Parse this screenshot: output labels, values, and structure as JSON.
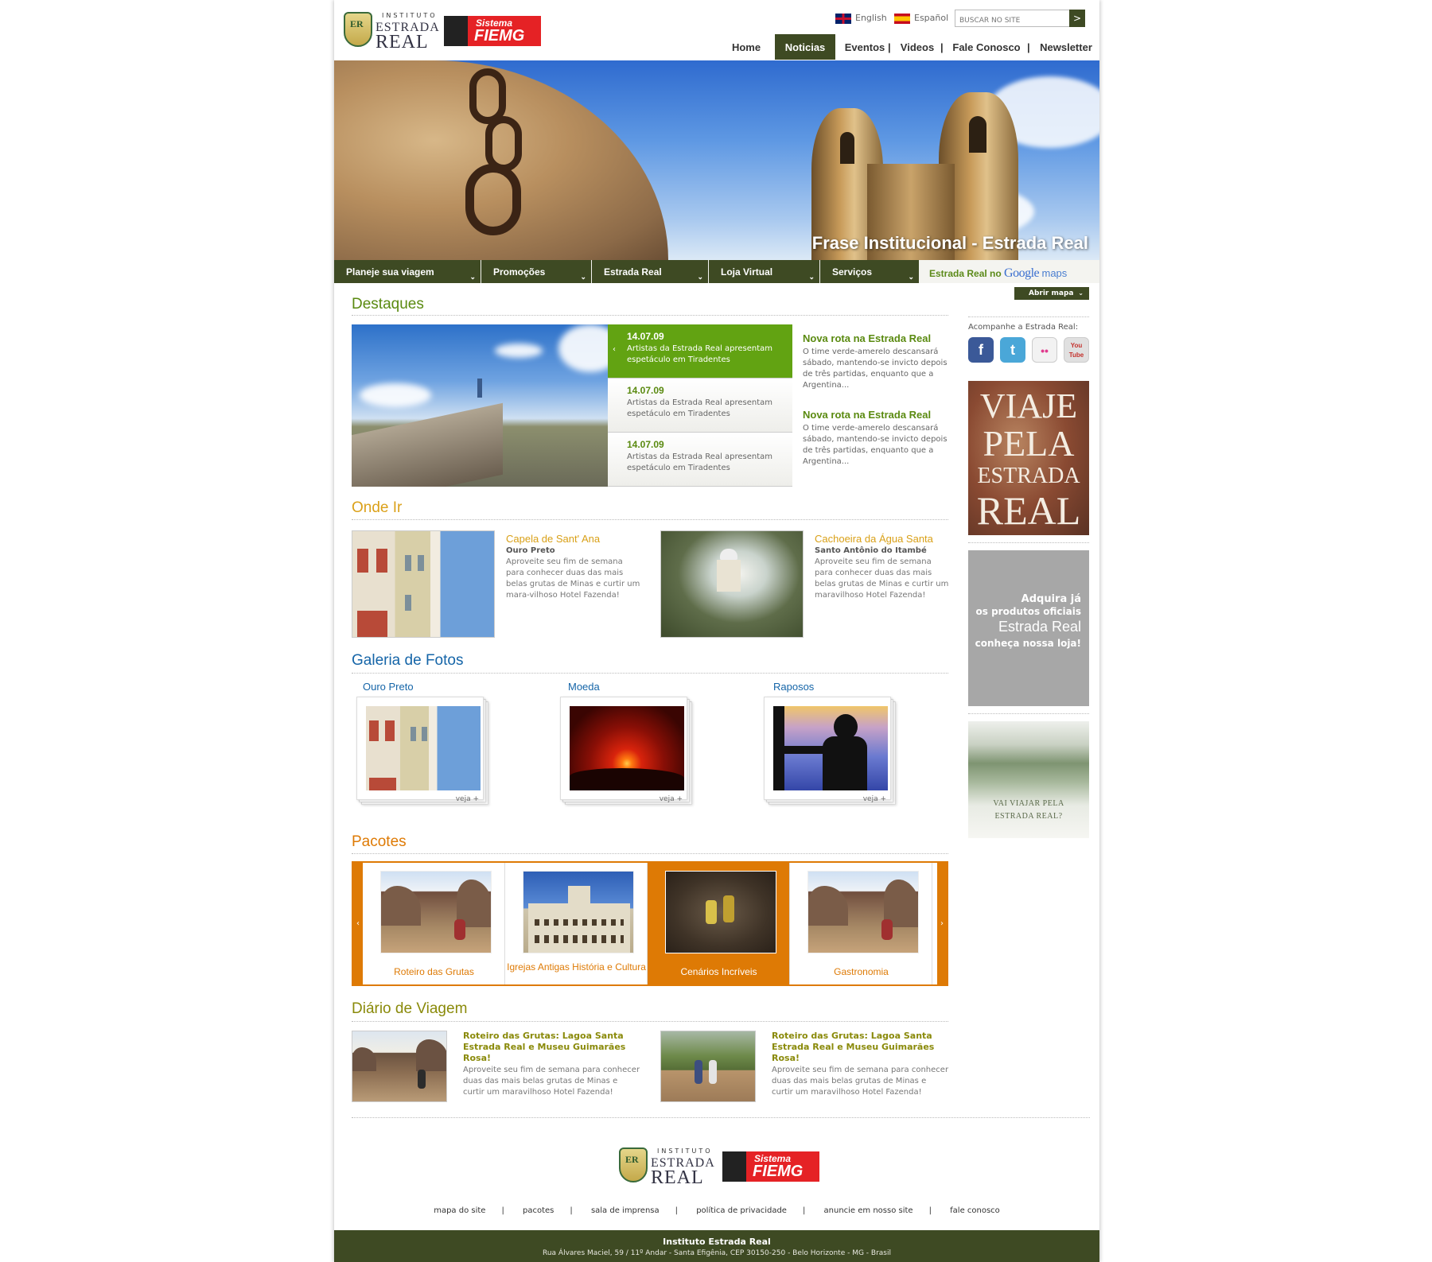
{
  "header": {
    "logo_instituto": {
      "small": "INSTITUTO",
      "line1": "ESTRADA",
      "line2": "REAL",
      "mark": "ER"
    },
    "logo_fiemg": {
      "line1": "Sistema",
      "line2": "FIEMG"
    },
    "languages": [
      {
        "label": "English",
        "flag": "uk-flag-icon"
      },
      {
        "label": "Español",
        "flag": "spain-flag-icon"
      }
    ],
    "search": {
      "placeholder": "BUSCAR NO SITE",
      "button": ">"
    },
    "nav": [
      "Home",
      "Noticias",
      "Eventos",
      "Videos",
      "Fale Conosco",
      "Newsletter"
    ],
    "nav_active": "Noticias",
    "nav_separator": "|"
  },
  "hero": {
    "caption": "Frase Institucional - Estrada Real"
  },
  "menu": {
    "items": [
      "Planeje sua viagem",
      "Promoções",
      "Estrada Real",
      "Loja Virtual",
      "Serviços"
    ],
    "dropdown_glyph": "⌄",
    "maps_prefix": "Estrada Real no",
    "maps_brand": "Google",
    "maps_suffix": "maps",
    "open_map": "Abrir mapa"
  },
  "destaques": {
    "title": "Destaques",
    "items": [
      {
        "date": "14.07.09",
        "text": "Artistas da Estrada Real apresentam espetáculo em Tiradentes"
      },
      {
        "date": "14.07.09",
        "text": "Artistas da Estrada Real apresentam espetáculo em Tiradentes"
      },
      {
        "date": "14.07.09",
        "text": "Artistas da Estrada Real apresentam espetáculo em Tiradentes"
      }
    ],
    "news": [
      {
        "title": "Nova rota na Estrada Real",
        "text": "O time verde-amerelo descansará sábado, mantendo-se invicto depois de três partidas, enquanto que a Argentina..."
      },
      {
        "title": "Nova rota na Estrada Real",
        "text": "O time verde-amerelo descansará sábado, mantendo-se invicto depois de três partidas, enquanto que a Argentina..."
      }
    ]
  },
  "onde_ir": {
    "title": "Onde Ir",
    "items": [
      {
        "title": "Capela de Sant' Ana",
        "place": "Ouro Preto",
        "text": "Aproveite seu fim de semana para conhecer duas das mais belas grutas de Minas e curtir um mara-vilhoso Hotel Fazenda!"
      },
      {
        "title": "Cachoeira da Água Santa",
        "place": "Santo Antônio do Itambé",
        "text": "Aproveite seu fim de semana para conhecer duas das mais belas grutas de Minas e curtir um maravilhoso Hotel Fazenda!"
      }
    ]
  },
  "galeria": {
    "title": "Galeria de Fotos",
    "items": [
      {
        "label": "Ouro Preto",
        "more": "veja +"
      },
      {
        "label": "Moeda",
        "more": "veja +"
      },
      {
        "label": "Raposos",
        "more": "veja +"
      }
    ]
  },
  "pacotes": {
    "title": "Pacotes",
    "prev": "‹",
    "next": "›",
    "items": [
      {
        "label": "Roteiro das Grutas"
      },
      {
        "label": "Igrejas Antigas História e Cultura"
      },
      {
        "label": "Cenários Incríveis"
      },
      {
        "label": "Gastronomia"
      }
    ],
    "active_index": 2
  },
  "diario": {
    "title": "Diário de Viagem",
    "items": [
      {
        "title": "Roteiro das Grutas: Lagoa Santa Estrada Real e Museu Guimarães Rosa!",
        "text": "Aproveite seu fim de semana para conhecer duas das mais belas grutas de Minas e curtir um maravilhoso Hotel Fazenda!"
      },
      {
        "title": "Roteiro das Grutas: Lagoa Santa Estrada Real e Museu Guimarães Rosa!",
        "text": "Aproveite seu fim de semana para conhecer duas das mais belas grutas de Minas e curtir um maravilhoso Hotel Fazenda!"
      }
    ]
  },
  "sidebar": {
    "follow": "Acompanhe a Estrada Real:",
    "social": [
      {
        "icon": "facebook-icon",
        "glyph": "f",
        "color": "#3b5998"
      },
      {
        "icon": "twitter-icon",
        "glyph": "t",
        "color": "#4aa7d8"
      },
      {
        "icon": "flickr-icon",
        "glyph": "••",
        "color": "#f4f4f4"
      },
      {
        "icon": "youtube-icon",
        "glyph": "You Tube",
        "color": "#d8d8d8"
      }
    ],
    "viaje": [
      "VIAJE",
      "PELA",
      "ESTRADA",
      "REAL"
    ],
    "loja": {
      "l1": "Adquira já",
      "l2": "os produtos oficiais",
      "l3": "Estrada Real",
      "l4": "conheça nossa loja!"
    },
    "vai": [
      "VAI VIAJAR PELA",
      "ESTRADA REAL?"
    ]
  },
  "footer": {
    "links": [
      "mapa do site",
      "pacotes",
      "sala de imprensa",
      "política de privacidade",
      "anuncie em nosso site",
      "fale conosco"
    ],
    "separator": "|",
    "name": "Instituto Estrada Real",
    "address": "Rua Álvares Maciel, 59 / 11º Andar - Santa Efigênia, CEP 30150-250 - Belo Horizonte - MG - Brasil"
  },
  "colors": {
    "brand_dark": "#3e4a23",
    "green": "#5a8a10",
    "active_green": "#62a312",
    "orange": "#de7a05",
    "yellow": "#d9a017",
    "blue": "#1565a8"
  }
}
